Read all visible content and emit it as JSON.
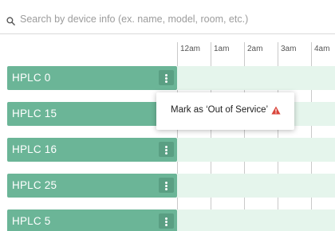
{
  "search": {
    "placeholder": "Search by device info (ex. name, model, room, etc.)",
    "icon": "search-icon"
  },
  "timeline": {
    "hours": [
      "12am",
      "1am",
      "2am",
      "3am",
      "4am"
    ]
  },
  "devices": [
    {
      "name": "HPLC 0"
    },
    {
      "name": "HPLC 15"
    },
    {
      "name": "HPLC 16"
    },
    {
      "name": "HPLC 25"
    },
    {
      "name": "HPLC 5"
    }
  ],
  "context_menu": {
    "item_label": "Mark as ‘Out of Service’",
    "icon": "warning-icon"
  },
  "colors": {
    "device_bar": "#6bb597",
    "menu_button": "#5a9f83",
    "row_band": "#e5f5ec",
    "warning": "#d9453b"
  }
}
